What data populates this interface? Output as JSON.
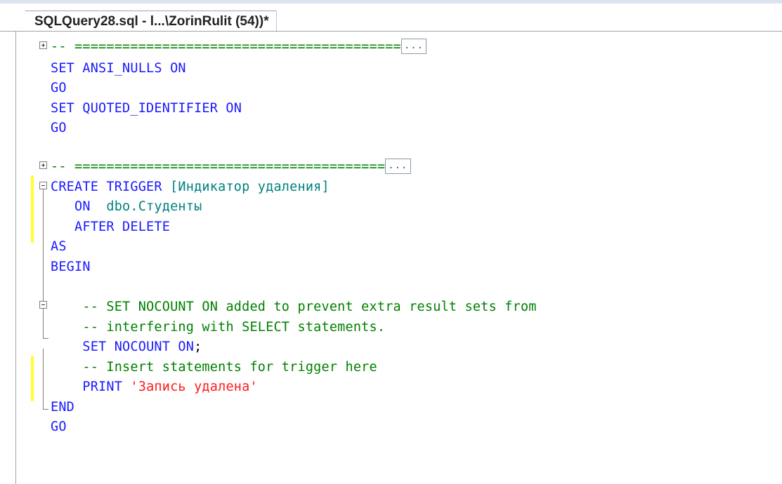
{
  "tab": {
    "title": "SQLQuery28.sql - l...\\ZorinRulit (54))*"
  },
  "lines": {
    "l1": {
      "prefix": "-- ",
      "rule": "=========================================",
      "ellipsis": "..."
    },
    "l2": {
      "kw1": "SET ANSI_NULLS ON"
    },
    "l3": {
      "kw1": "GO"
    },
    "l4": {
      "kw1": "SET QUOTED_IDENTIFIER ON"
    },
    "l5": {
      "kw1": "GO"
    },
    "l6": {
      "prefix": "-- ",
      "rule": "=======================================",
      "ellipsis": "..."
    },
    "l7": {
      "kw1": "CREATE TRIGGER ",
      "plain1": "[Индикатор удаления]"
    },
    "l8": {
      "kw1": "ON ",
      "obj1": " dbo.Студенты"
    },
    "l9": {
      "kw1": "AFTER DELETE"
    },
    "l10": {
      "kw1": "AS"
    },
    "l11": {
      "kw1": "BEGIN"
    },
    "l12": {
      "cm1": "-- SET NOCOUNT ON added to prevent extra result sets from"
    },
    "l13": {
      "cm1": "-- interfering with SELECT statements."
    },
    "l14": {
      "kw1": "SET NOCOUNT ON",
      "plain1": ";"
    },
    "l15": {
      "cm1": "-- Insert statements for trigger here"
    },
    "l16": {
      "kw1": "PRINT ",
      "str1": "'Запись удалена'"
    },
    "l17": {
      "kw1": "END"
    },
    "l18": {
      "kw1": "GO"
    }
  }
}
